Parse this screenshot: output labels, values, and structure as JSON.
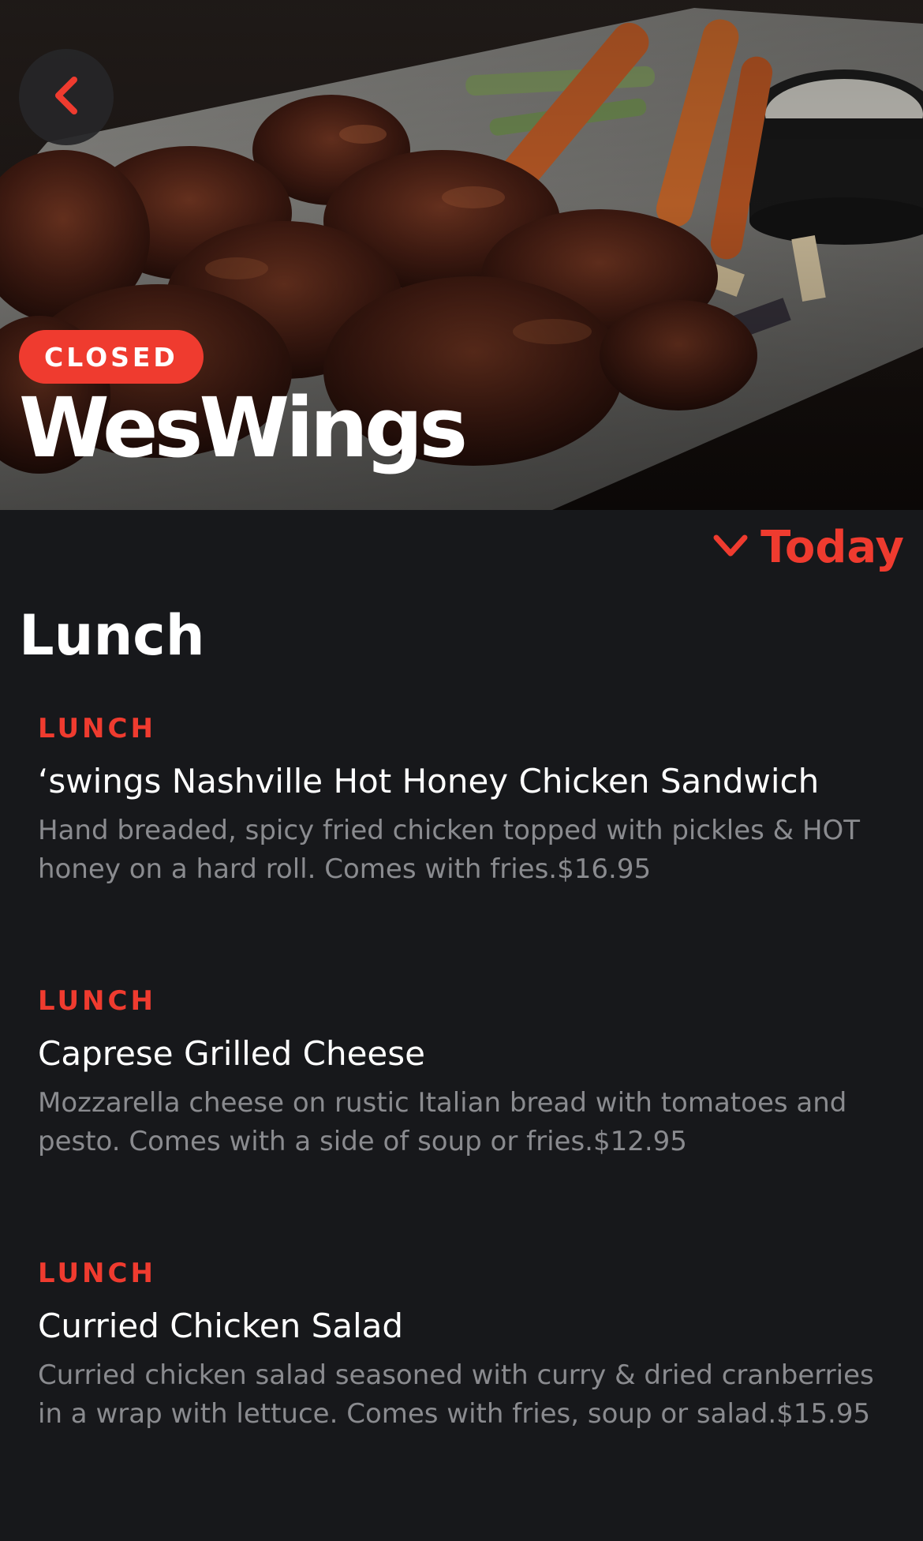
{
  "hero": {
    "status": "CLOSED",
    "title": "WesWings"
  },
  "day_selector": {
    "label": "Today"
  },
  "section": {
    "title": "Lunch"
  },
  "menu_items": [
    {
      "category": "LUNCH",
      "name": "‘swings Nashville Hot Honey Chicken Sandwich",
      "description": "Hand breaded, spicy fried chicken topped with pickles & HOT honey on a hard roll. Comes with fries.$16.95"
    },
    {
      "category": "LUNCH",
      "name": "Caprese Grilled Cheese",
      "description": "Mozzarella cheese on rustic Italian bread with tomatoes and pesto. Comes with a side of soup or fries.$12.95"
    },
    {
      "category": "LUNCH",
      "name": "Curried Chicken Salad",
      "description": "Curried chicken salad seasoned with curry & dried cranberries in a wrap with lettuce. Comes with fries, soup or salad.$15.95"
    }
  ],
  "colors": {
    "accent": "#ef3b2f",
    "background": "#17181b",
    "text_primary": "#ffffff",
    "text_secondary": "#8a8b8f"
  },
  "icons": {
    "back": "chevron-left-icon",
    "day_selector": "chevron-down-icon"
  }
}
